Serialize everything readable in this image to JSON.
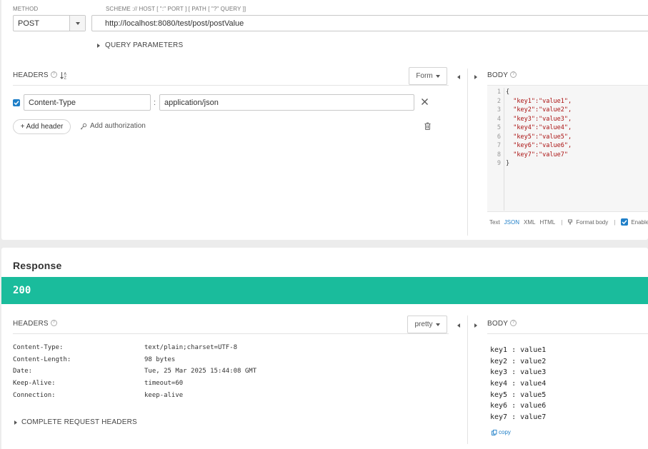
{
  "request": {
    "method_label": "METHOD",
    "method_value": "POST",
    "url_label": "SCHEME :// HOST [ \":\" PORT ] [ PATH [ \"?\" QUERY ]]",
    "url_value": "http://localhost:8080/test/post/postValue",
    "query_params_label": "QUERY PARAMETERS",
    "headers_label": "HEADERS",
    "headers_mode": "Form",
    "header_rows": [
      {
        "enabled": true,
        "name": "Content-Type",
        "value": "application/json"
      }
    ],
    "header_separator": ":",
    "add_header_label": "+ Add header",
    "add_auth_label": "Add authorization",
    "body_label": "BODY",
    "body_lines": [
      {
        "n": "1",
        "text": "{"
      },
      {
        "n": "2",
        "text": "  \"key1\":\"value1\","
      },
      {
        "n": "3",
        "text": "  \"key2\":\"value2\","
      },
      {
        "n": "4",
        "text": "  \"key3\":\"value3\","
      },
      {
        "n": "5",
        "text": "  \"key4\":\"value4\","
      },
      {
        "n": "6",
        "text": "  \"key5\":\"value5\","
      },
      {
        "n": "7",
        "text": "  \"key6\":\"value6\","
      },
      {
        "n": "8",
        "text": "  \"key7\":\"value7\""
      },
      {
        "n": "9",
        "text": "}"
      }
    ],
    "body_formats": [
      "Text",
      "JSON",
      "XML",
      "HTML"
    ],
    "body_format_selected": "JSON",
    "format_body_label": "Format body",
    "enable_label": "Enable b",
    "pipe": "|"
  },
  "response": {
    "title": "Response",
    "status_code": "200",
    "status_color": "#1abc9c",
    "headers_label": "HEADERS",
    "headers_mode": "pretty",
    "headers": [
      {
        "name": "Content-Type:",
        "value": "text/plain;charset=UTF-8"
      },
      {
        "name": "Content-Length:",
        "value": "98 bytes"
      },
      {
        "name": "Date:",
        "value": "Tue, 25 Mar 2025 15:44:08 GMT"
      },
      {
        "name": "Keep-Alive:",
        "value": "timeout=60"
      },
      {
        "name": "Connection:",
        "value": "keep-alive"
      }
    ],
    "complete_request_headers_label": "COMPLETE REQUEST HEADERS",
    "body_label": "BODY",
    "body_lines": [
      "key1 : value1",
      "key2 : value2",
      "key3 : value3",
      "key4 : value4",
      "key5 : value5",
      "key6 : value6",
      "key7 : value7"
    ],
    "copy_label": "copy"
  },
  "colors": {
    "accent": "#1f7fc8",
    "status_green": "#1abc9c"
  }
}
